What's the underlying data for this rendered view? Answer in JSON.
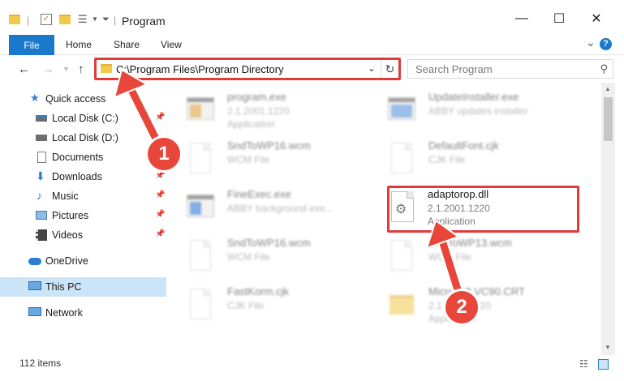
{
  "window": {
    "title": "Program",
    "minimize": "—",
    "maximize": "☐",
    "close": "✕"
  },
  "ribbon": {
    "file": "File",
    "home": "Home",
    "share": "Share",
    "view": "View",
    "collapse": "⌄",
    "help": "?"
  },
  "address": {
    "path": "C:\\Program Files\\Program Directory",
    "search_placeholder": "Search Program"
  },
  "sidebar": {
    "items": [
      {
        "label": "Quick access"
      },
      {
        "label": "Local Disk (C:)"
      },
      {
        "label": "Local Disk (D:)"
      },
      {
        "label": "Documents"
      },
      {
        "label": "Downloads"
      },
      {
        "label": "Music"
      },
      {
        "label": "Pictures"
      },
      {
        "label": "Videos"
      },
      {
        "label": "OneDrive"
      },
      {
        "label": "This PC"
      },
      {
        "label": "Network"
      }
    ]
  },
  "files": [
    {
      "name": "program.exe",
      "meta1": "2.1.2001.1220",
      "meta2": "Application"
    },
    {
      "name": "UpdateInstaller.exe",
      "meta1": "ABBY updates installer",
      "meta2": ""
    },
    {
      "name": "SndToWP16.wcm",
      "meta1": "WCM File",
      "meta2": ""
    },
    {
      "name": "DefaultFont.cjk",
      "meta1": "CJK File",
      "meta2": ""
    },
    {
      "name": "FineExec.exe",
      "meta1": "ABBY background exe...",
      "meta2": ""
    },
    {
      "name": "adaptorop.dll",
      "meta1": "2.1.2001.1220",
      "meta2": "Application"
    },
    {
      "name": "SndToWP16.wcm",
      "meta1": "WCM File",
      "meta2": ""
    },
    {
      "name": "SndToWP13.wcm",
      "meta1": "WCM File",
      "meta2": ""
    },
    {
      "name": "FastKorm.cjk",
      "meta1": "CJK File",
      "meta2": ""
    },
    {
      "name": "Microsoft.VC90.CRT",
      "meta1": "2.1.2001.1220",
      "meta2": "Application"
    }
  ],
  "status": {
    "count": "112 items"
  },
  "callouts": {
    "one": "1",
    "two": "2"
  },
  "colors": {
    "accent": "#1979ca",
    "annotation": "#e03a3a",
    "selection": "#cce4f7"
  }
}
